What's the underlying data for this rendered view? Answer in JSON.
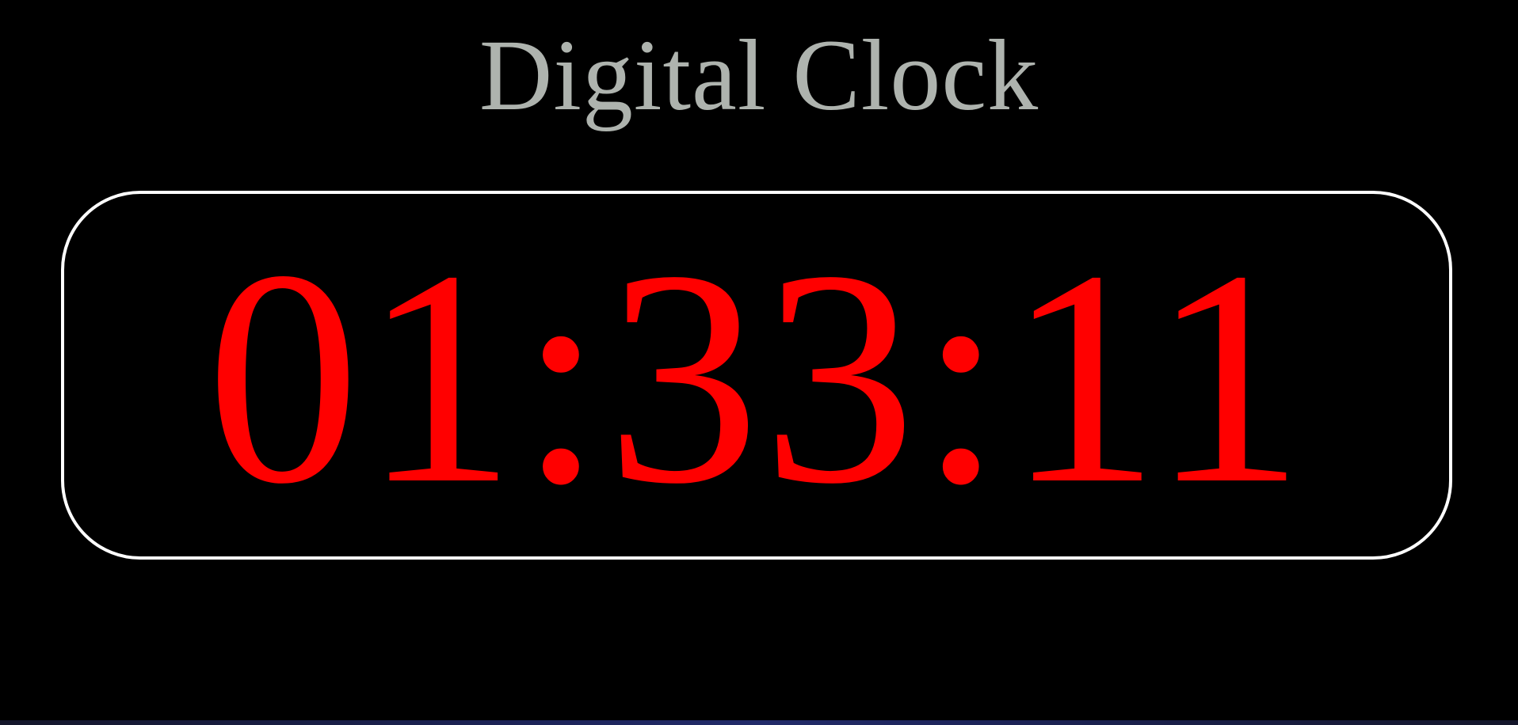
{
  "page": {
    "title": "Digital Clock"
  },
  "clock": {
    "time": "01:33:11"
  },
  "colors": {
    "background": "#000000",
    "title": "#aeb3ae",
    "digits": "#ff0000",
    "frame_border": "#ffffff"
  }
}
